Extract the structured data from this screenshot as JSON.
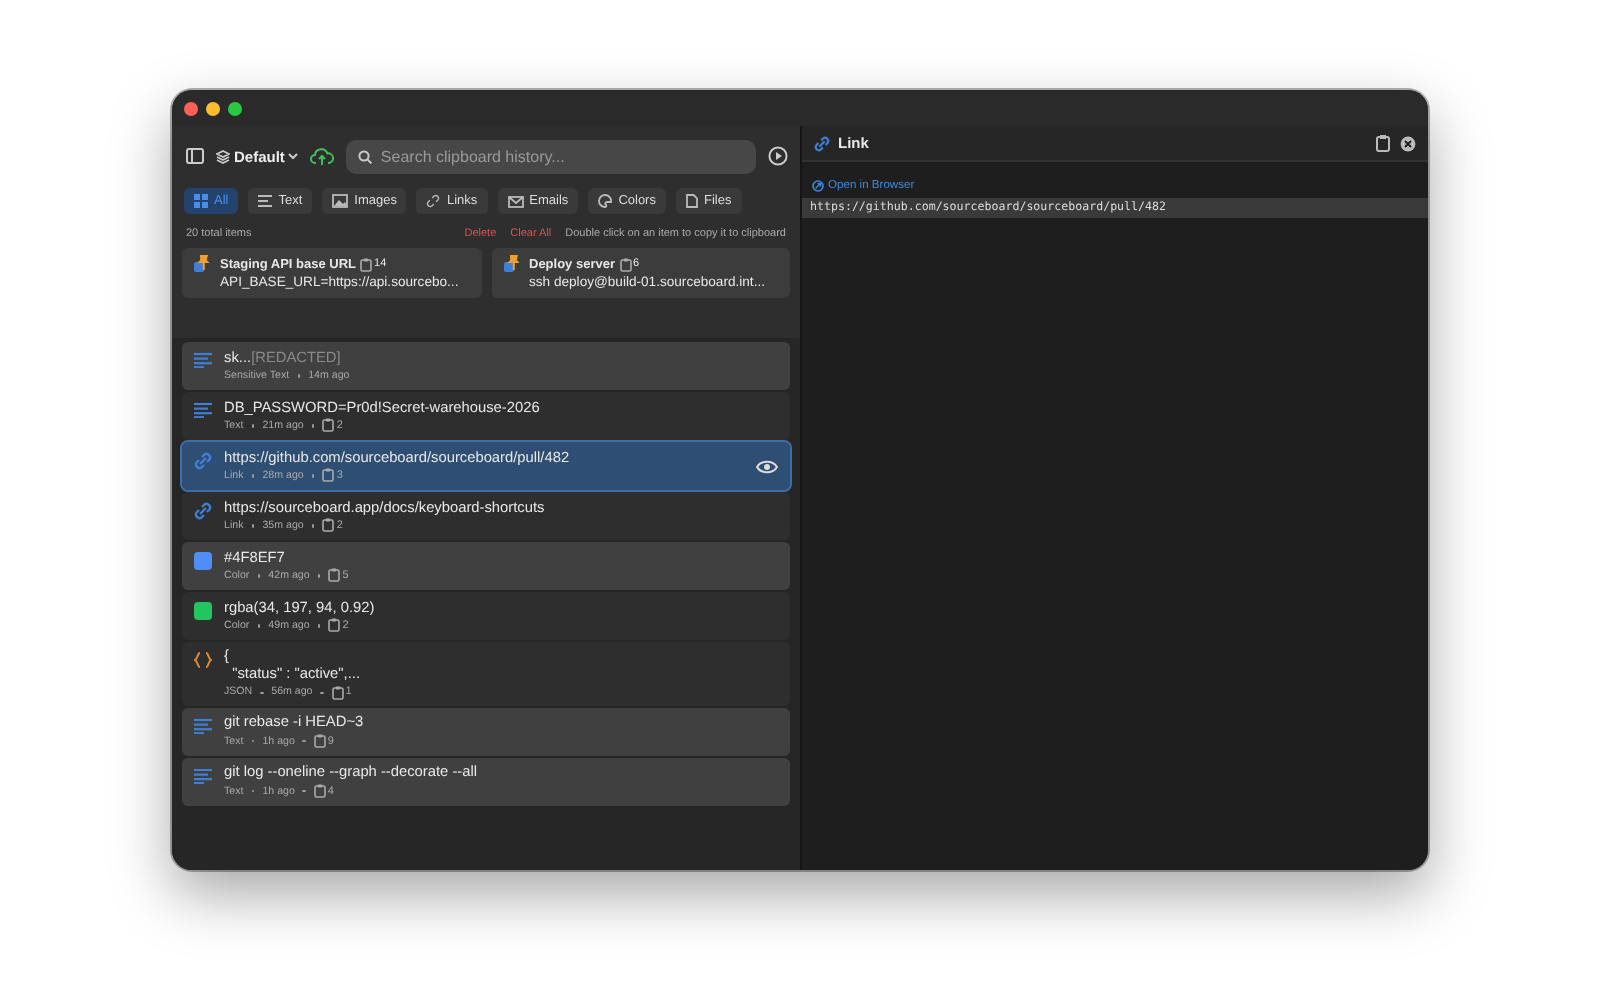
{
  "toolbar": {
    "profile": "Default",
    "search": {
      "placeholder": "Search clipboard history..."
    }
  },
  "filters": [
    {
      "kind": "all",
      "label": "All",
      "selected": true
    },
    {
      "kind": "text",
      "label": "Text",
      "selected": false
    },
    {
      "kind": "images",
      "label": "Images",
      "selected": false
    },
    {
      "kind": "links",
      "label": "Links",
      "selected": false
    },
    {
      "kind": "emails",
      "label": "Emails",
      "selected": false
    },
    {
      "kind": "colors",
      "label": "Colors",
      "selected": false
    },
    {
      "kind": "files",
      "label": "Files",
      "selected": false
    }
  ],
  "summary": {
    "count": "20 total items",
    "delete": "Delete",
    "clear": "Clear All",
    "hint": "Double click on an item to copy it to clipboard"
  },
  "pinned": [
    {
      "title": "Staging API base URL",
      "copies": "14",
      "content": "API_BASE_URL=https://api.sourcebo..."
    },
    {
      "title": "Deploy server",
      "copies": "6",
      "content": "ssh deploy@build-01.sourceboard.int..."
    }
  ],
  "items": [
    {
      "kind": "text",
      "text": "sk...",
      "redacted": "[REDACTED]",
      "type": "Sensitive Text",
      "time": "14m ago",
      "shaded": true,
      "selected": false
    },
    {
      "kind": "text",
      "text": "DB_PASSWORD=Pr0d!Secret-warehouse-2026",
      "type": "Text",
      "time": "21m ago",
      "copies": "2",
      "shaded": false,
      "selected": false
    },
    {
      "kind": "link",
      "text": "https://github.com/sourceboard/sourceboard/pull/482",
      "type": "Link",
      "time": "28m ago",
      "copies": "3",
      "shaded": false,
      "selected": true
    },
    {
      "kind": "link",
      "text": "https://sourceboard.app/docs/keyboard-shortcuts",
      "type": "Link",
      "time": "35m ago",
      "copies": "2",
      "shaded": false,
      "selected": false
    },
    {
      "kind": "color",
      "color": "#4f8ef7",
      "text": "#4F8EF7",
      "type": "Color",
      "time": "42m ago",
      "copies": "5",
      "shaded": true,
      "selected": false
    },
    {
      "kind": "color",
      "color": "#22c55e",
      "text": "rgba(34, 197, 94, 0.92)",
      "type": "Color",
      "time": "49m ago",
      "copies": "2",
      "shaded": false,
      "selected": false
    },
    {
      "kind": "json",
      "text": "{\n  \"status\" : \"active\",...",
      "type": "JSON",
      "time": "56m ago",
      "copies": "1",
      "shaded": false,
      "selected": false
    },
    {
      "kind": "text",
      "text": "git rebase -i HEAD~3",
      "type": "Text",
      "time": "1h ago",
      "copies": "9",
      "shaded": true,
      "selected": false
    },
    {
      "kind": "text",
      "text": "git log --oneline --graph --decorate --all",
      "type": "Text",
      "time": "1h ago",
      "copies": "4",
      "shaded": true,
      "selected": false
    }
  ],
  "detail": {
    "title": "Link",
    "action": "Open in Browser",
    "content": "https://github.com/sourceboard/sourceboard/pull/482"
  }
}
